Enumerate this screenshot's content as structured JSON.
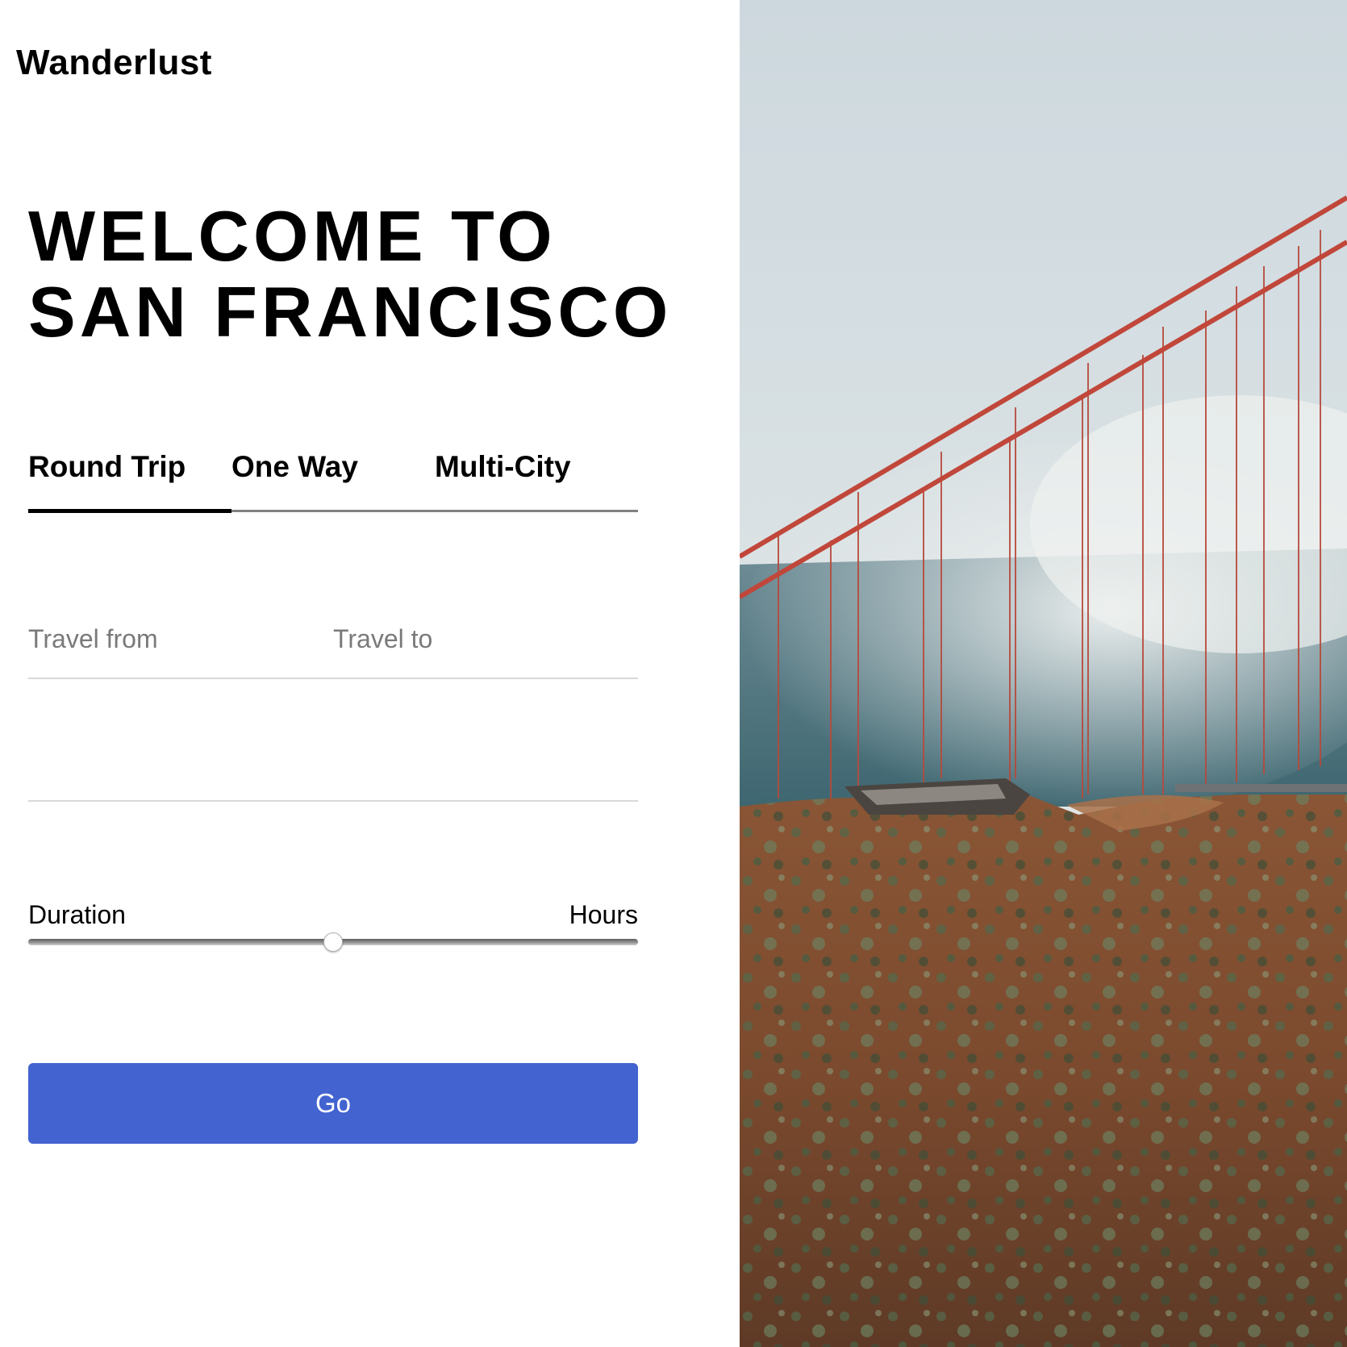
{
  "brand": {
    "name": "Wanderlust"
  },
  "hero": {
    "line1": "WELCOME TO",
    "line2": "SAN FRANCISCO"
  },
  "tabs": {
    "items": [
      {
        "label": "Round Trip",
        "active": true
      },
      {
        "label": "One Way",
        "active": false
      },
      {
        "label": "Multi-City",
        "active": false
      }
    ]
  },
  "form": {
    "from": {
      "placeholder": "Travel from",
      "value": ""
    },
    "to": {
      "placeholder": "Travel to",
      "value": ""
    },
    "dates": {
      "placeholder": "",
      "value": ""
    },
    "duration": {
      "label": "Duration",
      "unit_label": "Hours",
      "value_fraction": 0.5
    },
    "submit_label": "Go"
  },
  "photo": {
    "subject": "golden-gate-bridge-fog-photo"
  },
  "colors": {
    "accent": "#4263d0",
    "tab_indicator": "#000000",
    "tab_track": "#808080",
    "divider": "#d9d9d9"
  }
}
